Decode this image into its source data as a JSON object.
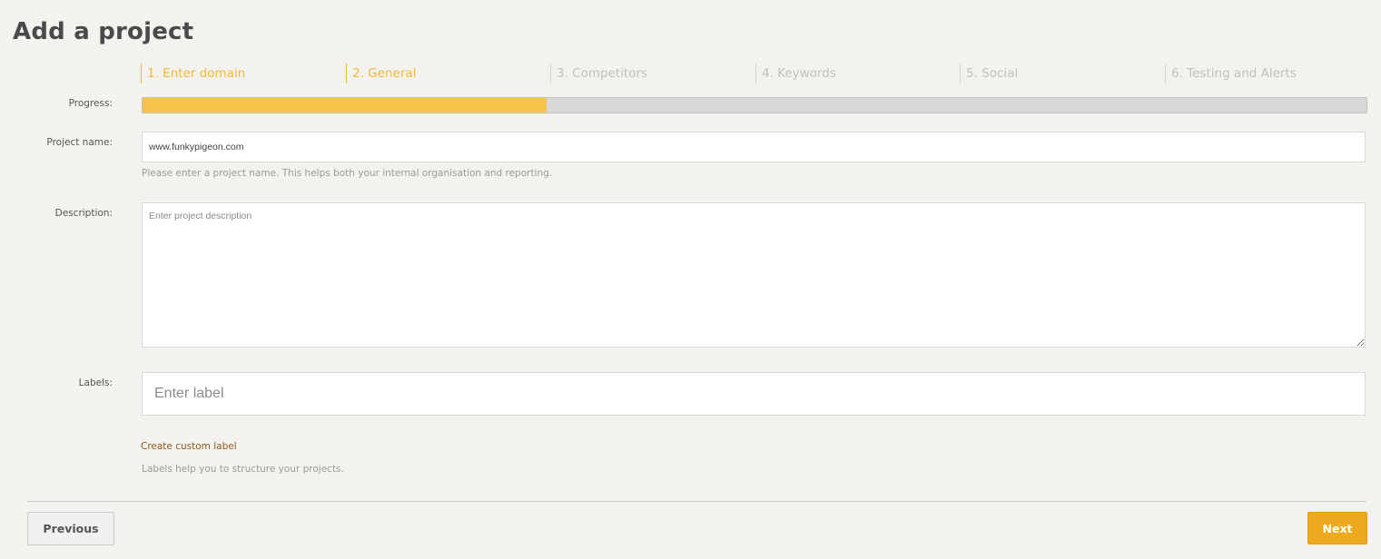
{
  "page": {
    "title": "Add a project"
  },
  "steps": [
    {
      "label": "1. Enter domain",
      "state": "completed"
    },
    {
      "label": "2. General",
      "state": "current"
    },
    {
      "label": "3. Competitors",
      "state": "upcoming"
    },
    {
      "label": "4. Keywords",
      "state": "upcoming"
    },
    {
      "label": "5. Social",
      "state": "upcoming"
    },
    {
      "label": "6. Testing and Alerts",
      "state": "upcoming"
    }
  ],
  "progress": {
    "label": "Progress:",
    "percent": 33
  },
  "project_name": {
    "label": "Project name:",
    "value": "www.funkypigeon.com",
    "help": "Please enter a project name. This helps both your internal organisation and reporting."
  },
  "description": {
    "label": "Description:",
    "value": "",
    "placeholder": "Enter project description"
  },
  "labels": {
    "label": "Labels:",
    "placeholder": "Enter label",
    "create_link": "Create custom label",
    "help": "Labels help you to structure your projects."
  },
  "buttons": {
    "previous": "Previous",
    "next": "Next"
  },
  "colors": {
    "accent": "#efa91e",
    "progress_fill": "#f7c346",
    "link": "#8b5a1c"
  }
}
